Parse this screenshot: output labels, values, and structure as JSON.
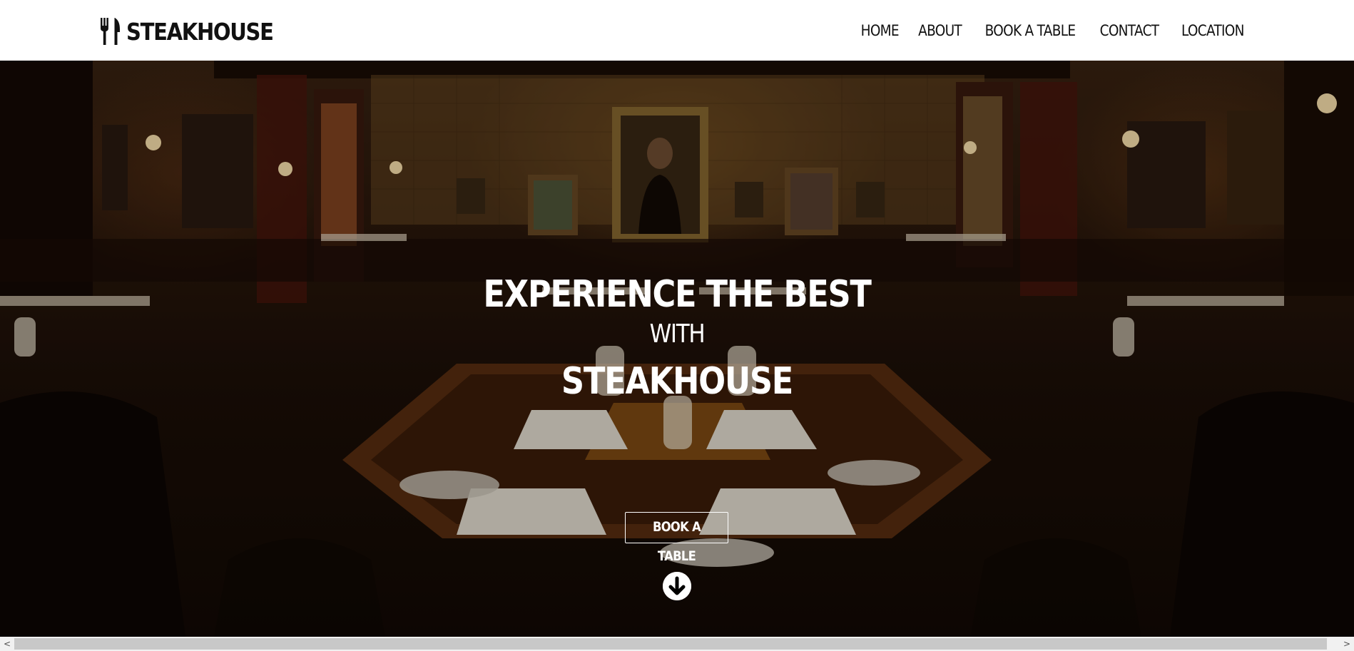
{
  "brand": {
    "name": "STEAKHOUSE",
    "icon": "fork-knife-icon"
  },
  "nav": {
    "items": [
      {
        "label": "HOME"
      },
      {
        "label": "ABOUT"
      },
      {
        "label": "BOOK A TABLE"
      },
      {
        "label": "CONTACT"
      },
      {
        "label": "LOCATION"
      }
    ]
  },
  "hero": {
    "line1": "EXPERIENCE THE BEST",
    "line2": "WITH",
    "line3": "STEAKHOUSE",
    "cta_label": "BOOK A TABLE",
    "scroll_icon": "arrow-down-circle-icon",
    "background": "restaurant-dining-room-photo"
  },
  "scrollbar": {
    "left_arrow": "<",
    "right_arrow": ">"
  },
  "colors": {
    "header_bg": "#ffffff",
    "text_dark": "#111111",
    "hero_text": "#ffffff"
  }
}
